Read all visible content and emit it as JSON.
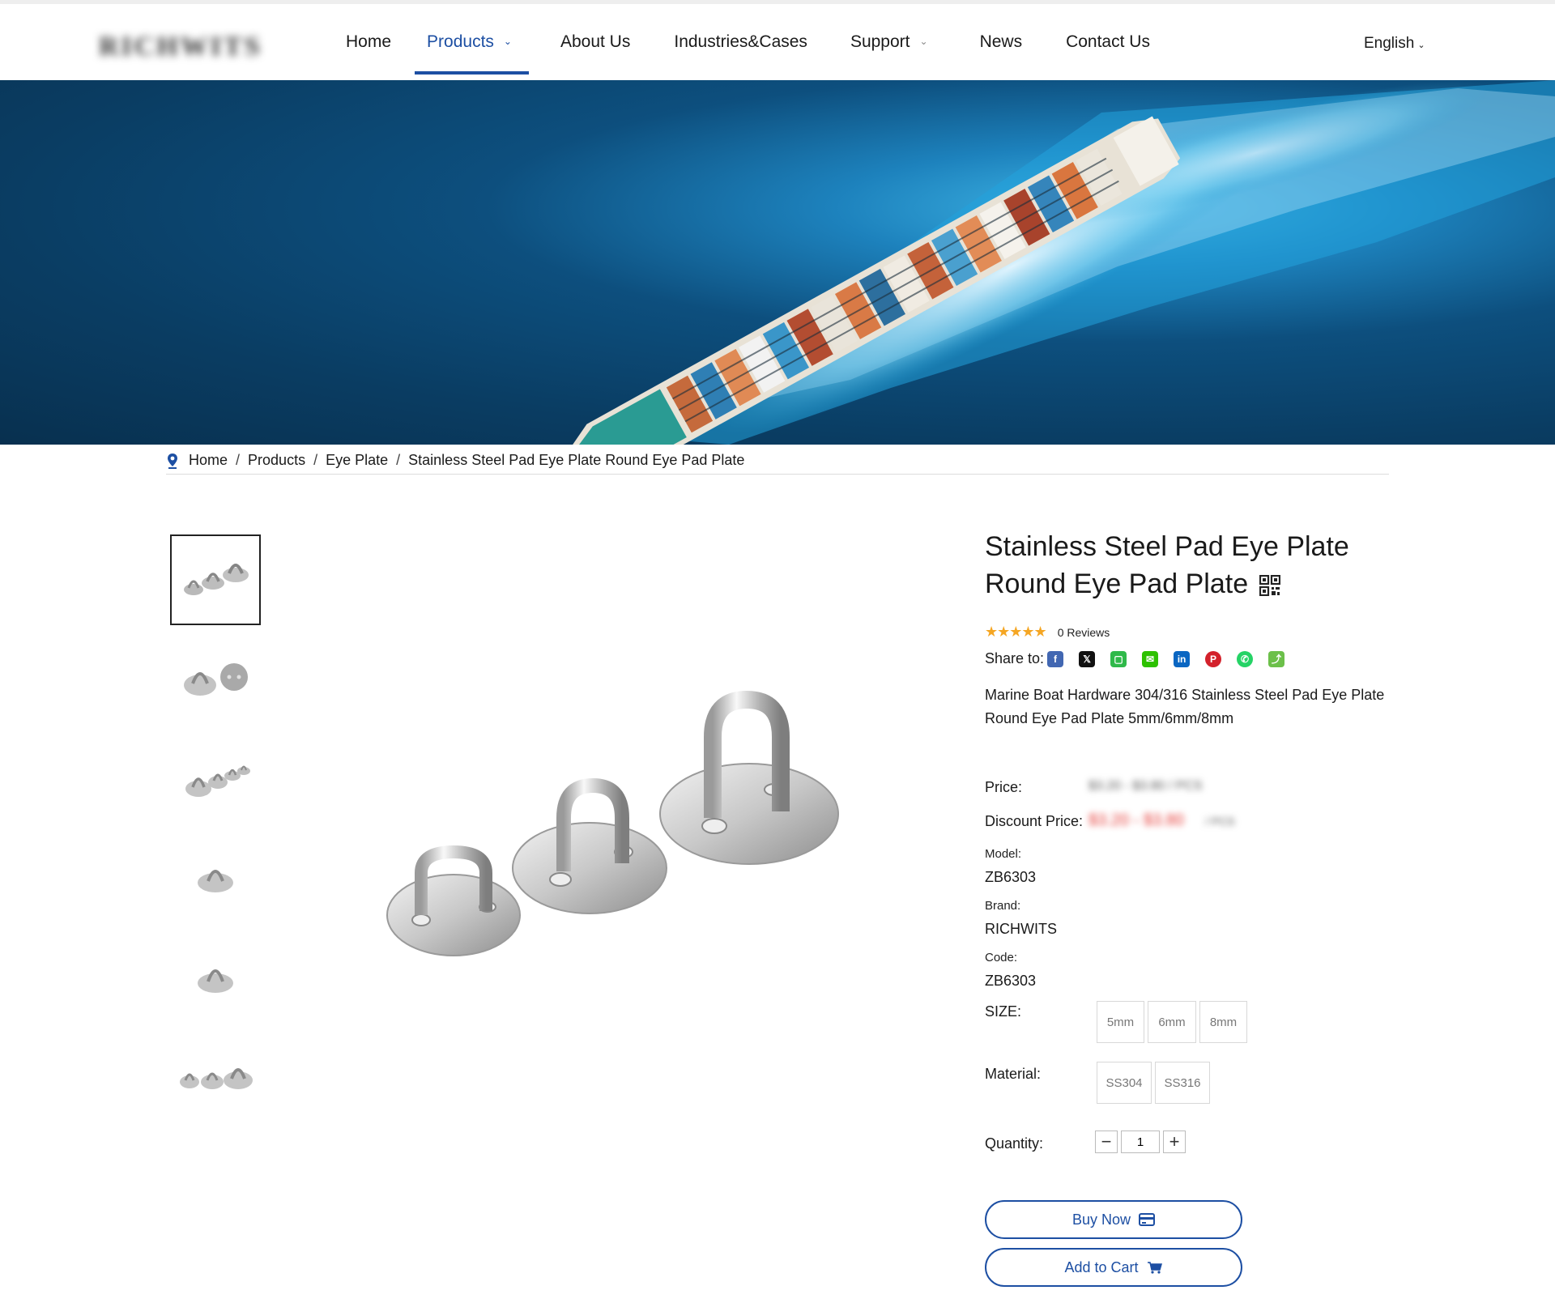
{
  "header": {
    "logo_text": "RICHWITS",
    "nav": [
      {
        "label": "Home",
        "active": false,
        "has_dropdown": false
      },
      {
        "label": "Products",
        "active": true,
        "has_dropdown": true
      },
      {
        "label": "About Us",
        "active": false,
        "has_dropdown": false
      },
      {
        "label": "Industries&Cases",
        "active": false,
        "has_dropdown": false
      },
      {
        "label": "Support",
        "active": false,
        "has_dropdown": true
      },
      {
        "label": "News",
        "active": false,
        "has_dropdown": false
      },
      {
        "label": "Contact Us",
        "active": false,
        "has_dropdown": false
      }
    ],
    "language": "English",
    "accent_color": "#1d4fa3"
  },
  "breadcrumb": {
    "items": [
      "Home",
      "Products",
      "Eye Plate",
      "Stainless Steel Pad Eye Plate Round Eye Pad Plate"
    ],
    "separator": "/"
  },
  "gallery": {
    "thumbnail_count": 6,
    "selected_index": 0
  },
  "product": {
    "title": "Stainless Steel Pad Eye Plate Round Eye Pad Plate",
    "rating_stars": 5,
    "reviews_label": "0 Reviews",
    "share_label": "Share to:",
    "share_icons": [
      "facebook-icon",
      "x-icon",
      "line-icon",
      "wechat-icon",
      "linkedin-icon",
      "pinterest-icon",
      "whatsapp-icon",
      "share-icon"
    ],
    "description": "Marine Boat Hardware 304/316 Stainless Steel Pad Eye Plate Round Eye Pad Plate 5mm/6mm/8mm",
    "price_label": "Price:",
    "price_value": "$3.20 - $3.80 / PCS",
    "discount_label": "Discount Price:",
    "discount_value": "$3.20 - $3.80",
    "discount_unit": "/ PCS",
    "model_label": "Model:",
    "model_value": "ZB6303",
    "brand_label": "Brand:",
    "brand_value": "RICHWITS",
    "code_label": "Code:",
    "code_value": "ZB6303",
    "size_label": "SIZE:",
    "sizes": [
      "5mm",
      "6mm",
      "8mm"
    ],
    "material_label": "Material:",
    "materials": [
      "SS304",
      "SS316"
    ],
    "quantity_label": "Quantity:",
    "quantity_value": "1",
    "buy_now_label": "Buy Now",
    "add_to_cart_label": "Add to Cart",
    "star_color": "#f5a623",
    "discount_color": "#e53935"
  }
}
